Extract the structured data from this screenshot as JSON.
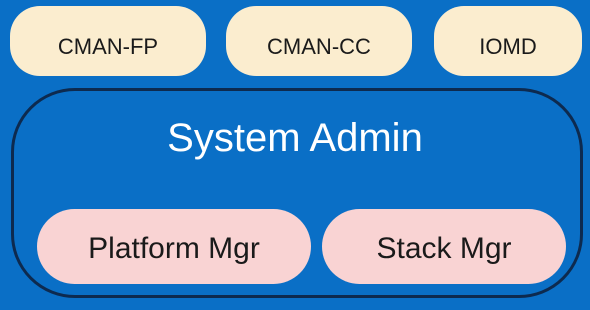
{
  "top_components": [
    {
      "label": "CMAN-FP"
    },
    {
      "label": "CMAN-CC"
    },
    {
      "label": "IOMD"
    }
  ],
  "system_admin": {
    "title": "System Admin",
    "components": [
      {
        "label": "Platform Mgr"
      },
      {
        "label": "Stack Mgr"
      }
    ]
  },
  "colors": {
    "background": "#0a6fc6",
    "top_pill": "#fbedcf",
    "inner_pill": "#f9d3d3",
    "border": "#0d2a4f"
  }
}
